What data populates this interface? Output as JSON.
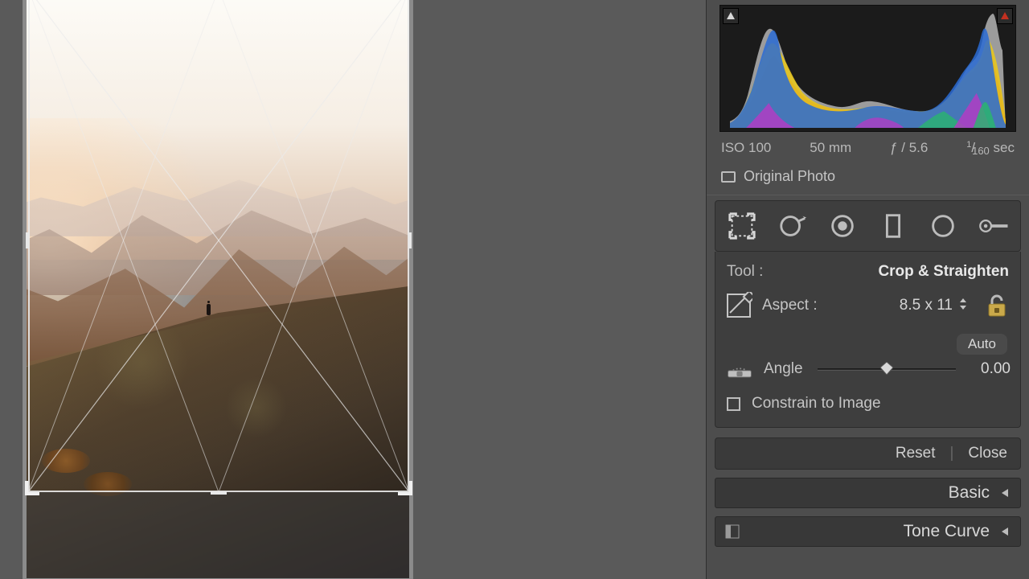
{
  "meta": {
    "iso": "ISO 100",
    "focal": "50 mm",
    "aperture": "ƒ / 5.6",
    "shutter_num": "1",
    "shutter_den": "160",
    "shutter_suffix": "sec"
  },
  "original_photo_label": "Original Photo",
  "tool": {
    "label": "Tool :",
    "name": "Crop & Straighten"
  },
  "aspect": {
    "label": "Aspect :",
    "value": "8.5 x 11"
  },
  "auto_label": "Auto",
  "angle": {
    "label": "Angle",
    "value": "0.00"
  },
  "constrain_label": "Constrain to Image",
  "reset": "Reset",
  "close": "Close",
  "sections": {
    "basic": "Basic",
    "tonecurve": "Tone Curve"
  }
}
